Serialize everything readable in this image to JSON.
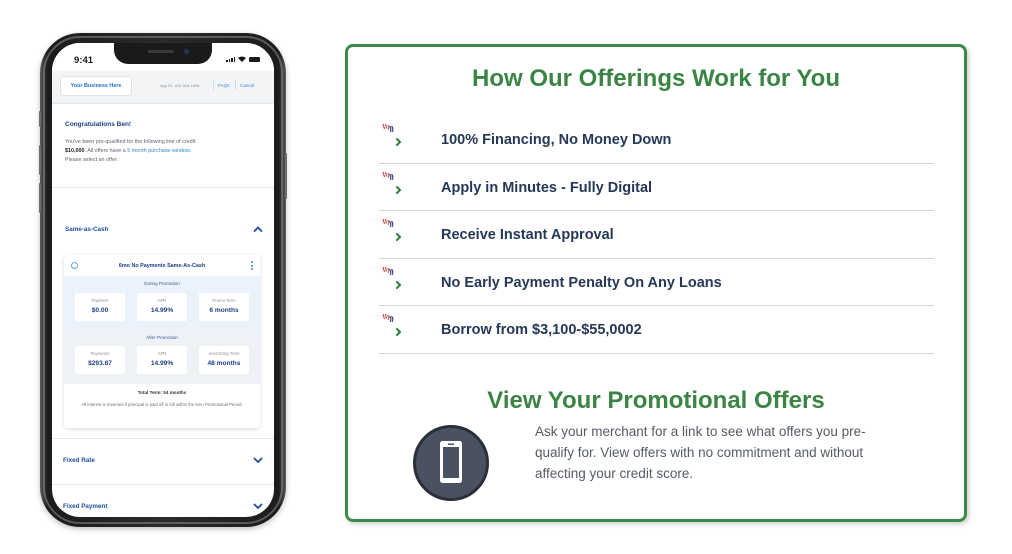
{
  "phone": {
    "status_time": "9:41",
    "header": {
      "business_button": "Your Business Here",
      "app_id": "App ID: 403-918-1098",
      "faqs_link": "FAQs",
      "cancel_link": "Cancel"
    },
    "greeting": "Congratulations Ben!",
    "intro": {
      "line1": "You've been pre-qualified for the following line of credit:",
      "amount": "$10,000",
      "mid": ". All offers have a ",
      "window_link": "5 month purchase window",
      "end": ".",
      "line3": "Please select an offer."
    },
    "sections": [
      {
        "label": "Same-as-Cash",
        "expanded": true
      },
      {
        "label": "Fixed Rate",
        "expanded": false
      },
      {
        "label": "Fixed Payment",
        "expanded": false
      }
    ],
    "offer": {
      "title": "6mo No Payments Same-As-Cash",
      "during_title": "During Promotion",
      "during": [
        {
          "label": "Payment",
          "value": "$0.00"
        },
        {
          "label": "APR",
          "value": "14.99%"
        },
        {
          "label": "Promo Term",
          "value": "6 months"
        }
      ],
      "after_title": "After Promotion",
      "after": [
        {
          "label": "Payments",
          "value": "$293.87"
        },
        {
          "label": "APR",
          "value": "14.99%"
        },
        {
          "label": "Amortizing Term",
          "value": "48 months"
        }
      ],
      "total_term": "Total Term: 54 months",
      "fine_print": "All interest is reversed if principal is paid off in full within the 6mo Promotional Period."
    }
  },
  "panel": {
    "title": "How Our Offerings Work for You",
    "features": [
      {
        "text": "100% Financing, No Money Down",
        "icon": "broken-image-chevron-icon"
      },
      {
        "text": "Apply in Minutes - Fully Digital",
        "icon": "broken-image-chevron-icon"
      },
      {
        "text": "Receive Instant Approval",
        "icon": "broken-image-chevron-icon"
      },
      {
        "text": "No Early Payment Penalty On Any Loans",
        "icon": "broken-image-chevron-icon"
      },
      {
        "text": "Borrow from $3,100-$55,0002",
        "icon": "broken-image-chevron-icon"
      }
    ],
    "promo_title": "View Your Promotional Offers",
    "promo_text": "Ask your merchant for a link to see what offers you pre-qualify for. View offers with no commitment and without affecting your credit score.",
    "promo_icon": "smartphone-icon"
  },
  "colors": {
    "brand_green": "#3a8444",
    "text_navy": "#253858",
    "link_blue": "#2e8bd3"
  }
}
